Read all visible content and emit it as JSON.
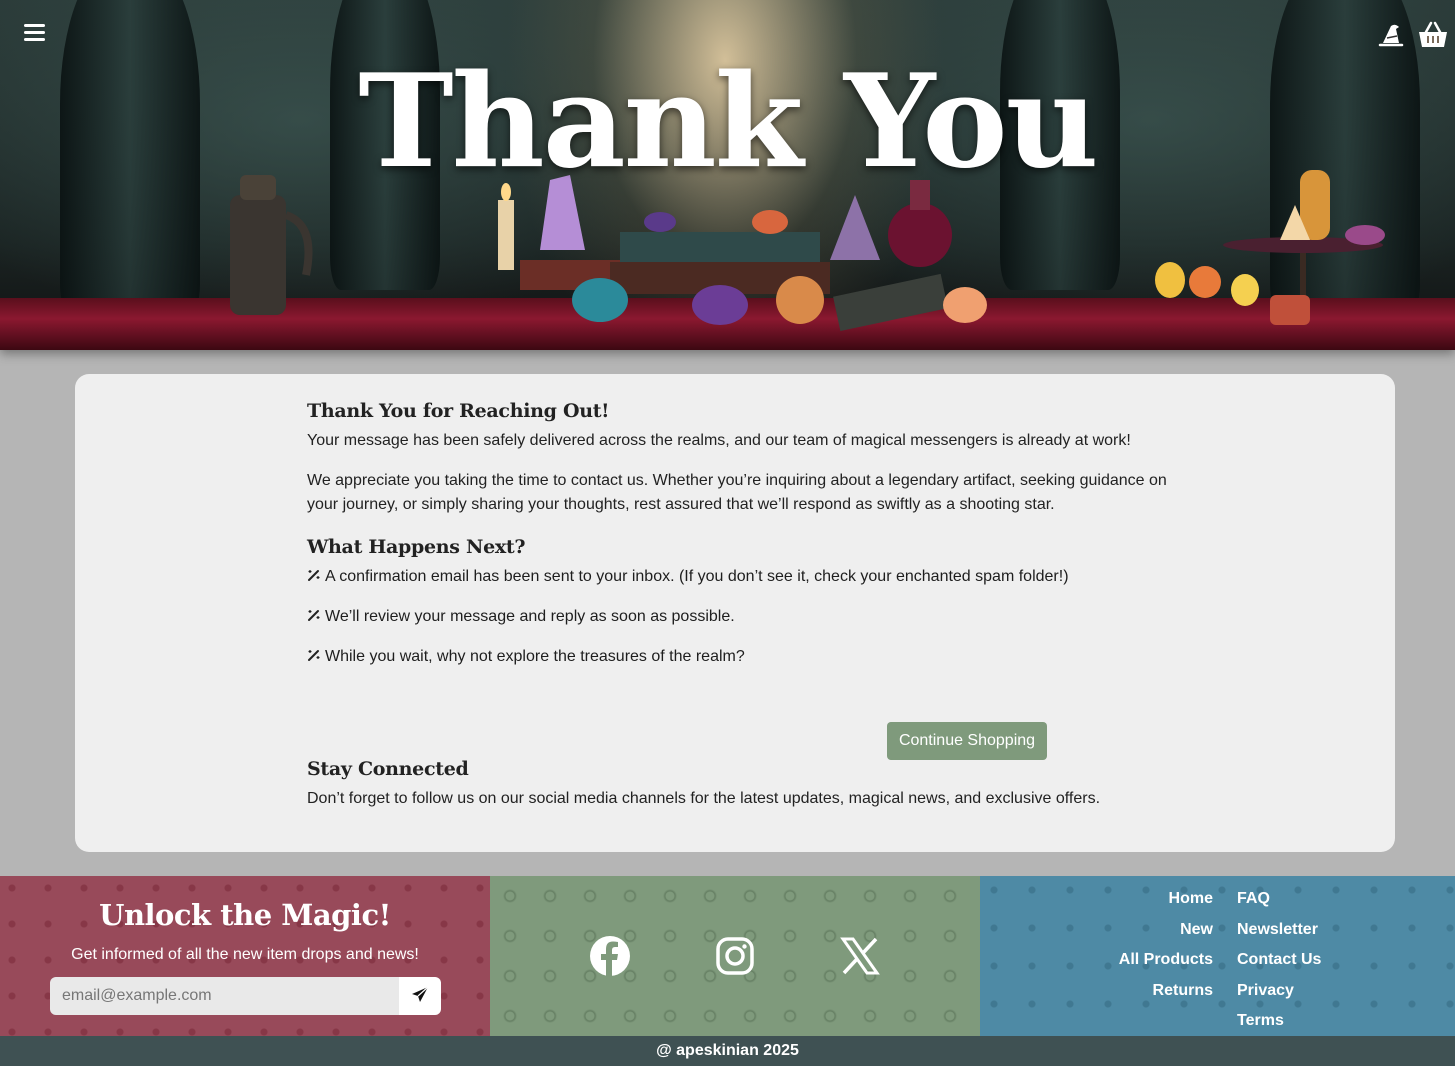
{
  "hero": {
    "title": "Thank You"
  },
  "header": {
    "menu_icon": "hamburger-menu-icon",
    "account_icon": "wizard-hat-icon",
    "cart_icon": "basket-icon"
  },
  "thankyou": {
    "heading": "Thank You for Reaching Out!",
    "intro": "Your message has been safely delivered across the realms, and our team of magical messengers is already at work!",
    "appreciation": "We appreciate you taking the time to contact us. Whether you’re inquiring about a legendary artifact, seeking guidance on your journey, or simply sharing your thoughts, rest assured that we’ll respond as swiftly as a shooting star.",
    "next_heading": "What Happens Next?",
    "next_items": [
      "A confirmation email has been sent to your inbox. (If you don’t see it, check your enchanted spam folder!)",
      "We’ll review your message and reply as soon as possible.",
      "While you wait, why not explore the treasures of the realm?"
    ],
    "cta_label": "Continue Shopping",
    "connected_heading": "Stay Connected",
    "connected_text": "Don’t forget to follow us on our social media channels for the latest updates, magical news, and exclusive offers."
  },
  "newsletter": {
    "title": "Unlock the Magic!",
    "subtitle": "Get informed of all the new item drops and news!",
    "email_placeholder": "email@example.com",
    "send_icon": "paper-plane-icon"
  },
  "social": [
    "facebook-icon",
    "instagram-icon",
    "x-icon"
  ],
  "footer_links": {
    "left": [
      "Home",
      "New",
      "All Products",
      "Returns"
    ],
    "right": [
      "FAQ",
      "Newsletter",
      "Contact Us",
      "Privacy",
      "Terms"
    ]
  },
  "copyright": "@ apeskinian 2025",
  "colors": {
    "card_bg": "#efefef",
    "page_bg": "#b5b5b5",
    "button_green": "#7f9a7c",
    "newsletter_bg": "#984a5a",
    "social_bg": "#7f9a7c",
    "links_bg": "#4e8aa5",
    "copyright_bg": "#3f5153"
  }
}
